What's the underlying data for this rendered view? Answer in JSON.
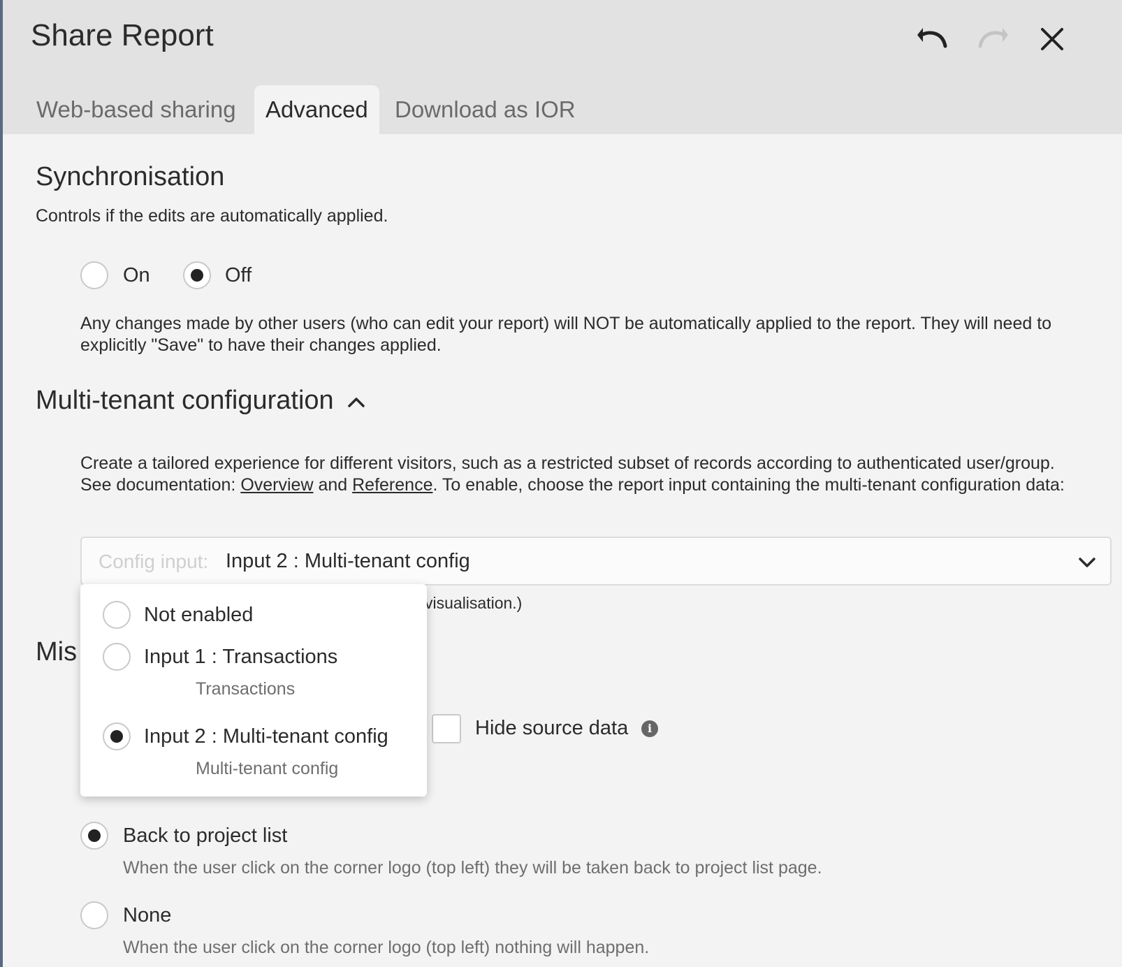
{
  "dialog": {
    "title": "Share Report"
  },
  "tabs": [
    {
      "label": "Web-based sharing",
      "active": false
    },
    {
      "label": "Advanced",
      "active": true
    },
    {
      "label": "Download as IOR",
      "active": false
    }
  ],
  "sync": {
    "title": "Synchronisation",
    "subtitle": "Controls if the edits are automatically applied.",
    "on_label": "On",
    "off_label": "Off",
    "selected": "Off",
    "description": "Any changes made by other users (who can edit your report) will NOT be automatically applied to the report. They will need to explicitly \"Save\" to have their changes applied."
  },
  "multitenant": {
    "title": "Multi-tenant configuration",
    "desc_part1": "Create a tailored experience for different visitors, such as a restricted subset of records according to authenticated user/group. See documentation: ",
    "link_overview": "Overview",
    "desc_and": " and ",
    "link_reference": "Reference",
    "desc_part2": ". To enable, choose the report input containing the multi-tenant configuration data:",
    "select_placeholder": "Config input:",
    "select_value": "Input 2 : Multi-tenant config",
    "hint_fragment": "visualisation.)"
  },
  "dropdown": {
    "options": [
      {
        "label": "Not enabled",
        "sub": "",
        "selected": false
      },
      {
        "label": "Input 1 : Transactions",
        "sub": "Transactions",
        "selected": false
      },
      {
        "label": "Input 2 : Multi-tenant config",
        "sub": "Multi-tenant config",
        "selected": true
      }
    ]
  },
  "misc": {
    "title_fragment": "Mis",
    "hide_source_label": "Hide source data"
  },
  "logo_click": {
    "back_label": "Back to project list",
    "back_desc": "When the user click on the corner logo (top left) they will be taken back to project list page.",
    "none_label": "None",
    "none_desc": "When the user click on the corner logo (top left) nothing will happen.",
    "selected": "Back to project list"
  }
}
